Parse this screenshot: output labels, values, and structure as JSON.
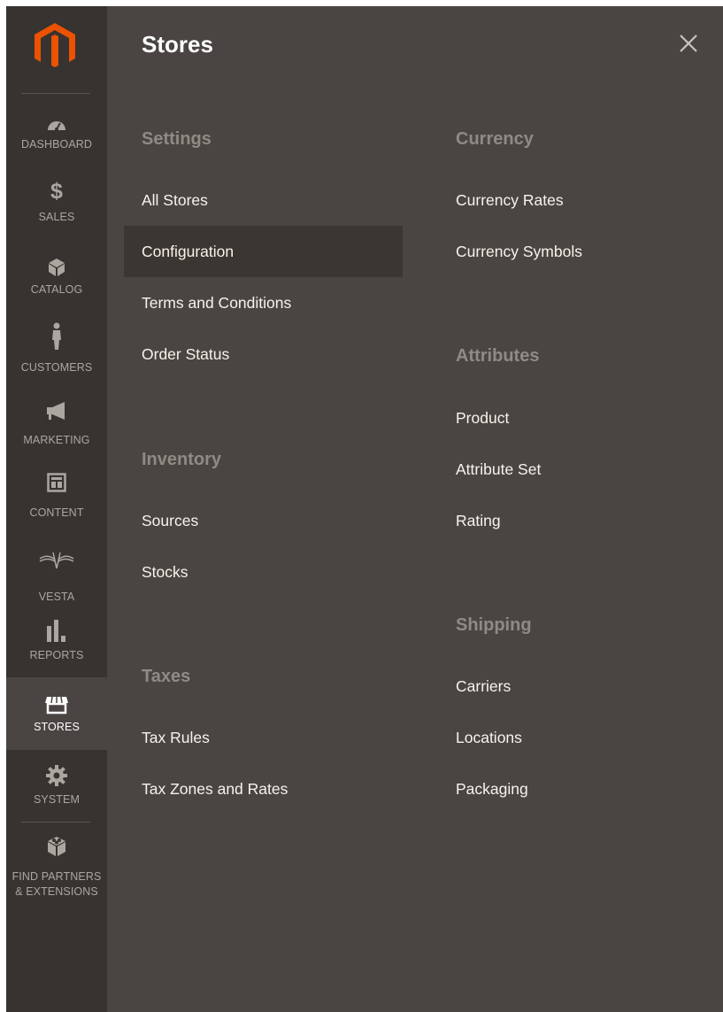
{
  "sidebar": {
    "logo": "magento-logo",
    "items": [
      {
        "label": "DASHBOARD",
        "icon": "dashboard-icon"
      },
      {
        "label": "SALES",
        "icon": "dollar-icon"
      },
      {
        "label": "CATALOG",
        "icon": "cube-icon"
      },
      {
        "label": "CUSTOMERS",
        "icon": "person-icon"
      },
      {
        "label": "MARKETING",
        "icon": "megaphone-icon"
      },
      {
        "label": "CONTENT",
        "icon": "layout-icon"
      },
      {
        "label": "VESTA",
        "icon": "vesta-wings-icon"
      },
      {
        "label": "REPORTS",
        "icon": "bar-chart-icon"
      },
      {
        "label": "STORES",
        "icon": "storefront-icon",
        "active": true
      },
      {
        "label": "SYSTEM",
        "icon": "gear-icon"
      },
      {
        "label": "FIND PARTNERS",
        "label2": "& EXTENSIONS",
        "icon": "bricks-icon"
      }
    ]
  },
  "panel": {
    "title": "Stores",
    "close_icon": "close-icon",
    "groups": {
      "settings": {
        "title": "Settings",
        "items": [
          "All Stores",
          "Configuration",
          "Terms and Conditions",
          "Order Status"
        ]
      },
      "inventory": {
        "title": "Inventory",
        "items": [
          "Sources",
          "Stocks"
        ]
      },
      "taxes": {
        "title": "Taxes",
        "items": [
          "Tax Rules",
          "Tax Zones and Rates"
        ]
      },
      "currency": {
        "title": "Currency",
        "items": [
          "Currency Rates",
          "Currency Symbols"
        ]
      },
      "attributes": {
        "title": "Attributes",
        "items": [
          "Product",
          "Attribute Set",
          "Rating"
        ]
      },
      "shipping": {
        "title": "Shipping",
        "items": [
          "Carriers",
          "Locations",
          "Packaging"
        ]
      }
    },
    "active_item": "Configuration"
  },
  "colors": {
    "sidebar_bg": "#373330",
    "panel_bg": "#4a4542",
    "active_link_bg": "#3c3633",
    "logo_orange": "#eb5202",
    "group_title": "#908a85",
    "link_text": "#f7f3eb"
  }
}
